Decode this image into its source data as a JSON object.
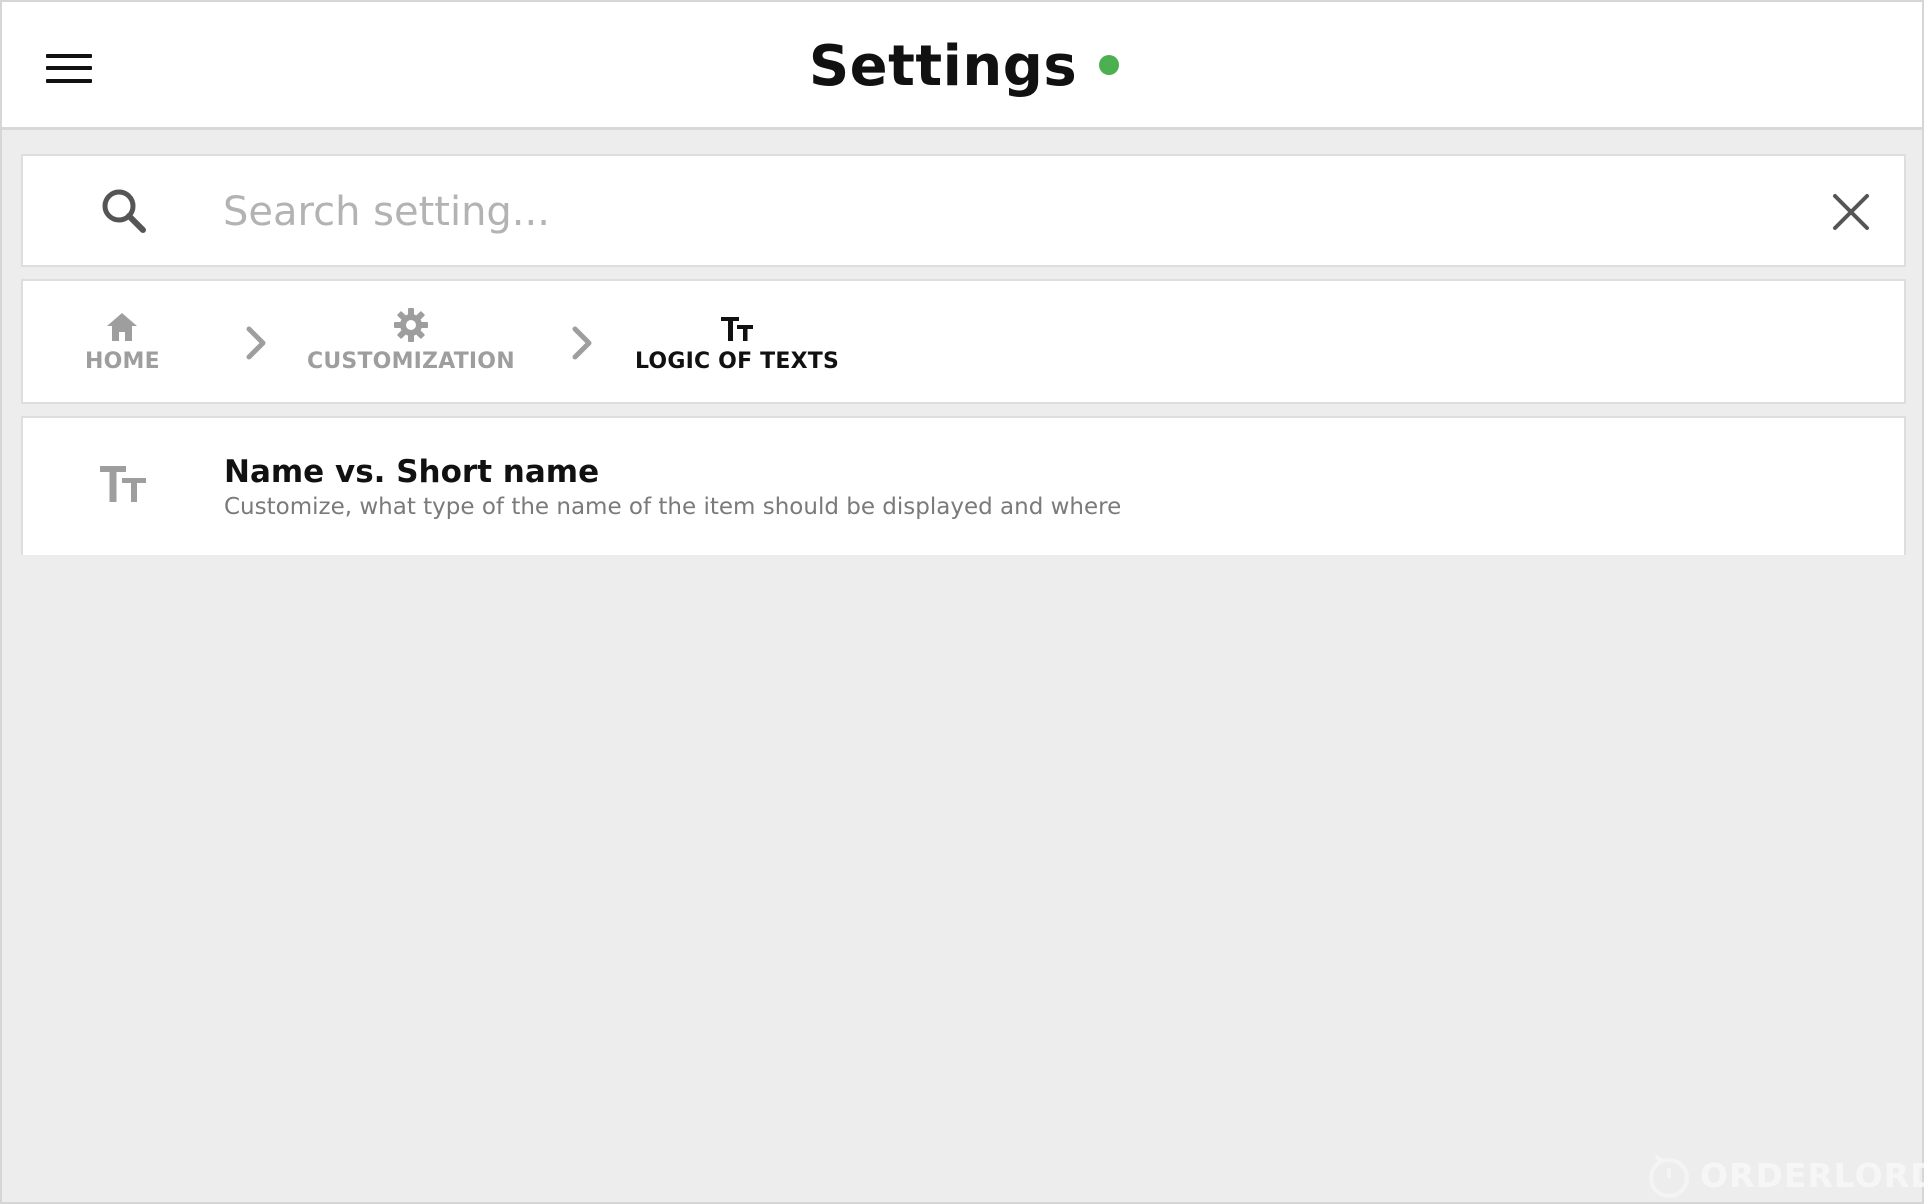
{
  "header": {
    "title": "Settings",
    "status_color": "#4caf50",
    "menu_icon": "hamburger-menu-icon"
  },
  "search": {
    "placeholder": "Search setting...",
    "value": "",
    "search_icon": "search-icon",
    "clear_icon": "close-icon"
  },
  "breadcrumb": {
    "items": [
      {
        "label": "HOME",
        "icon": "home-icon",
        "active": false
      },
      {
        "label": "CUSTOMIZATION",
        "icon": "gear-icon",
        "active": false
      },
      {
        "label": "LOGIC OF TEXTS",
        "icon": "text-size-icon",
        "active": true
      }
    ],
    "separator_icon": "chevron-right-icon",
    "inactive_color": "#9e9e9e",
    "active_color": "#111111"
  },
  "list": {
    "items": [
      {
        "title": "Name vs. Short name",
        "subtitle": "Customize, what type of the name of the item should be displayed and where",
        "icon": "text-size-icon"
      }
    ]
  },
  "colors": {
    "background": "#ededed",
    "card": "#ffffff",
    "accent_online": "#4caf50"
  },
  "watermark": {
    "text": "ORDERLORD",
    "icon": "orderlord-logo-icon"
  }
}
